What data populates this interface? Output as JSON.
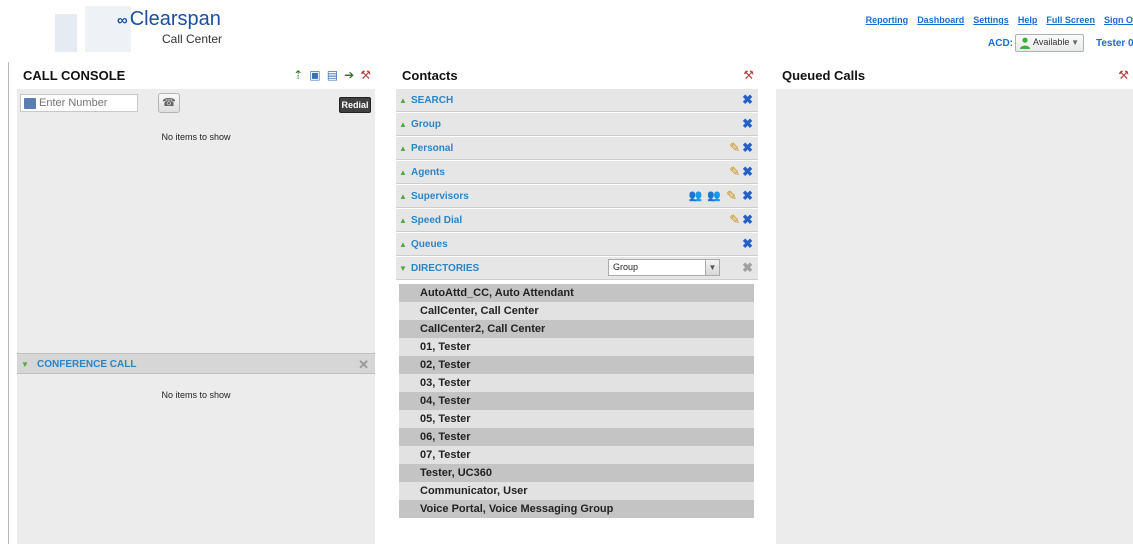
{
  "header": {
    "brand": "Clearspan",
    "product": "Call Center",
    "links": [
      "Reporting",
      "Dashboard",
      "Settings",
      "Help",
      "Full Screen",
      "Sign O"
    ],
    "acd_label": "ACD:",
    "acd_status": "Available",
    "user": "Tester 0"
  },
  "call_console": {
    "title": "CALL CONSOLE",
    "number_placeholder": "Enter Number",
    "redial_label": "Redial",
    "empty_text": "No items to show",
    "conference": {
      "title": "CONFERENCE CALL",
      "empty_text": "No items to show"
    }
  },
  "contacts": {
    "title": "Contacts",
    "sections": [
      {
        "label": "SEARCH"
      },
      {
        "label": "Group"
      },
      {
        "label": "Personal"
      },
      {
        "label": "Agents"
      },
      {
        "label": "Supervisors"
      },
      {
        "label": "Speed Dial"
      },
      {
        "label": "Queues"
      },
      {
        "label": "DIRECTORIES"
      }
    ],
    "directory_select_value": "Group",
    "directory_entries": [
      "AutoAttd_CC, Auto Attendant",
      "CallCenter, Call Center",
      "CallCenter2, Call Center",
      "01, Tester",
      "02, Tester",
      "03, Tester",
      "04, Tester",
      "05, Tester",
      "06, Tester",
      "07, Tester",
      "Tester, UC360",
      "Communicator, User",
      "Voice Portal, Voice Messaging Group"
    ]
  },
  "queued_calls": {
    "title": "Queued Calls"
  },
  "colors": {
    "link": "#1a6bd0",
    "section_label": "#2a85c6",
    "expand_triangle": "#55a83a",
    "close_blue": "#2760c4",
    "panel_bg": "#ececec"
  }
}
